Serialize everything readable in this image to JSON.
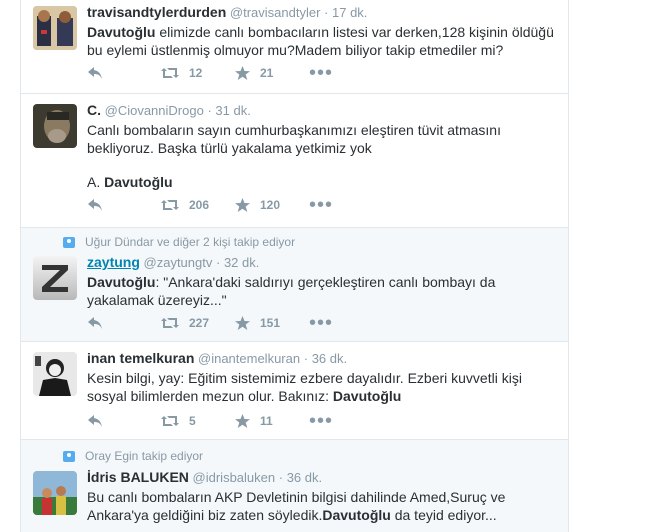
{
  "tweets": [
    {
      "name": "travisandtylerdurden",
      "handle": "@travisandtyler",
      "time": "17 dk.",
      "text_bold": "Davutoğlu",
      "text_rest": " elimizde canlı bombacıların listesi var derken,128 kişinin öldüğü bu eylemi üstlenmiş olmuyor mu?Madem biliyor takip etmediler mi?",
      "retweets": "12",
      "favorites": "21"
    },
    {
      "name": "C.",
      "handle": "@CiovanniDrogo",
      "time": "31 dk.",
      "text": "Canlı bombaların sayın cumhurbaşkanımızı eleştiren tüvit atmasını bekliyoruz. Başka türlü yakalama yetkimiz yok",
      "sign_prefix": "A. ",
      "sign_bold": "Davutoğlu",
      "retweets": "206",
      "favorites": "120"
    },
    {
      "context": "Uğur Dündar ve diğer 2 kişi takip ediyor",
      "name": "zaytung",
      "handle": "@zaytungtv",
      "time": "32 dk.",
      "text_bold": "Davutoğlu",
      "text_rest": ": \"Ankara'daki saldırıyı gerçekleştiren canlı bombayı da yakalamak üzereyiz...\"",
      "retweets": "227",
      "favorites": "151"
    },
    {
      "name": "inan temelkuran",
      "handle": "@inantemelkuran",
      "time": "36 dk.",
      "text_rest": "Kesin bilgi, yay: Eğitim sistemimiz ezbere dayalıdır. Ezberi kuvvetli kişi sosyal bilimlerden mezun olur. Bakınız: ",
      "text_bold": "Davutoğlu",
      "retweets": "5",
      "favorites": "11"
    },
    {
      "context": "Oray Egin takip ediyor",
      "name": "İdris BALUKEN",
      "handle": "@idrisbaluken",
      "time": "36 dk.",
      "text_rest": "Bu canlı bombaların AKP Devletinin bilgisi dahilinde Amed,Suruç ve Ankara'ya geldiğini biz zaten söyledik.",
      "text_bold": "Davutoğlu",
      "text_tail": " da teyid ediyor..."
    }
  ],
  "icons": [
    "reply-icon",
    "retweet-icon",
    "star-icon",
    "more-icon",
    "follow-context-icon"
  ],
  "colors": {
    "link": "#0084b4",
    "meta": "#8899a6",
    "border": "#e1e8ed",
    "context": "#55acee"
  }
}
